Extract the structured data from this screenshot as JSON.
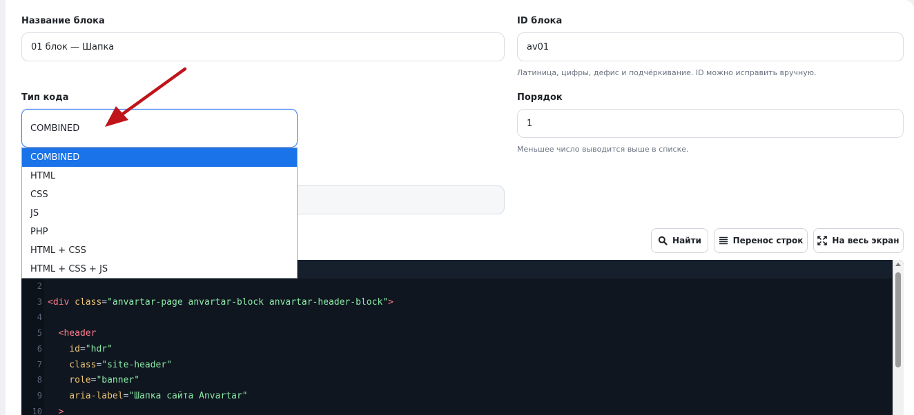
{
  "form": {
    "block_name": {
      "label": "Название блока",
      "value": "01 блок — Шапка"
    },
    "block_id": {
      "label": "ID блока",
      "value": "av01",
      "hint": "Латиница, цифры, дефис и подчёркивание. ID можно исправить вручную."
    },
    "code_type": {
      "label": "Тип кода",
      "value": "COMBINED",
      "options": [
        "COMBINED",
        "HTML",
        "CSS",
        "JS",
        "PHP",
        "HTML + CSS",
        "HTML + CSS + JS"
      ],
      "selected_index": 0
    },
    "order": {
      "label": "Порядок",
      "value": "1",
      "hint": "Меньшее число выводится выше в списке."
    }
  },
  "toolbar": {
    "find_label": "Найти",
    "wrap_label": "Перенос строк",
    "fullscreen_label": "На весь экран"
  },
  "editor": {
    "lines": [
      {
        "n": "2",
        "parts": []
      },
      {
        "n": "3",
        "parts": [
          {
            "t": "tag",
            "v": "<div "
          },
          {
            "t": "attr",
            "v": "class"
          },
          {
            "t": "pun",
            "v": "="
          },
          {
            "t": "str",
            "v": "\"anvartar-page anvartar-block anvartar-header-block\""
          },
          {
            "t": "tag",
            "v": ">"
          }
        ]
      },
      {
        "n": "4",
        "parts": []
      },
      {
        "n": "5",
        "parts": [
          {
            "t": "tag",
            "v": "  <header"
          }
        ]
      },
      {
        "n": "6",
        "parts": [
          {
            "t": "attr",
            "v": "    id"
          },
          {
            "t": "pun",
            "v": "="
          },
          {
            "t": "str",
            "v": "\"hdr\""
          }
        ]
      },
      {
        "n": "7",
        "parts": [
          {
            "t": "attr",
            "v": "    class"
          },
          {
            "t": "pun",
            "v": "="
          },
          {
            "t": "str",
            "v": "\"site-header\""
          }
        ]
      },
      {
        "n": "8",
        "parts": [
          {
            "t": "attr",
            "v": "    role"
          },
          {
            "t": "pun",
            "v": "="
          },
          {
            "t": "str",
            "v": "\"banner\""
          }
        ]
      },
      {
        "n": "9",
        "parts": [
          {
            "t": "attr",
            "v": "    aria-label"
          },
          {
            "t": "pun",
            "v": "="
          },
          {
            "t": "str",
            "v": "\"Шапка сайта Anvartar\""
          }
        ]
      },
      {
        "n": "10",
        "parts": [
          {
            "t": "tag",
            "v": "  >"
          }
        ]
      }
    ]
  },
  "colors": {
    "accent": "#1a73e8",
    "annotation_arrow": "#c0141b",
    "editor_bg": "#0f1620"
  }
}
